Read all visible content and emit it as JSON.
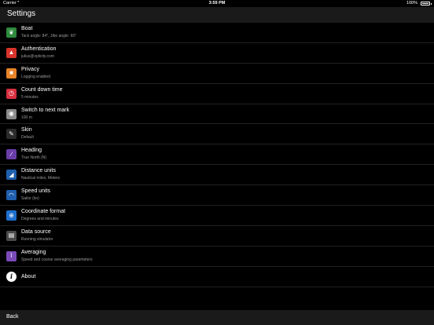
{
  "status_bar": {
    "carrier": "Carrier",
    "wifi_icon": "wifi-icon",
    "time": "3:59 PM",
    "battery_percent": "100%"
  },
  "nav": {
    "title": "Settings"
  },
  "settings": [
    {
      "label": "Boat",
      "sub": "Tack angle: 84°, Jibe angle: 60°",
      "icon": "leaf-icon",
      "color": "#2e8b3e",
      "glyph": "❦"
    },
    {
      "label": "Authentication",
      "sub": "julius@xplicity.com",
      "icon": "user-icon",
      "color": "#d9342b",
      "glyph": "▲"
    },
    {
      "label": "Privacy",
      "sub": "Logging enabled",
      "icon": "lock-icon",
      "color": "#e8832a",
      "glyph": "■"
    },
    {
      "label": "Count down time",
      "sub": "5 minutes",
      "icon": "timer-icon",
      "color": "#d93040",
      "glyph": "◷"
    },
    {
      "label": "Switch to next mark",
      "sub": "100 m",
      "icon": "target-icon",
      "color": "#8a8a8a",
      "glyph": "◉"
    },
    {
      "label": "Skin",
      "sub": "Default",
      "icon": "brush-icon",
      "color": "#2b2b2b",
      "glyph": "✎"
    },
    {
      "label": "Heading",
      "sub": "True North (N)",
      "icon": "heading-icon",
      "color": "#6a3ea8",
      "glyph": "∕"
    },
    {
      "label": "Distance units",
      "sub": "Nautical miles, Meters",
      "icon": "ruler-icon",
      "color": "#1f5fae",
      "glyph": "◢"
    },
    {
      "label": "Speed units",
      "sub": "Sailor (kn)",
      "icon": "speedometer-icon",
      "color": "#1f5fae",
      "glyph": "◠"
    },
    {
      "label": "Coordinate format",
      "sub": "Degrees and minutes",
      "icon": "globe-icon",
      "color": "#1f6fce",
      "glyph": "⊕"
    },
    {
      "label": "Data source",
      "sub": "Running simulator",
      "icon": "data-icon",
      "color": "#4a4a4a",
      "glyph": "▤"
    },
    {
      "label": "Averaging",
      "sub": "Speed and course averaging parameters",
      "icon": "graph-icon",
      "color": "#7a4ab8",
      "glyph": "⌇"
    }
  ],
  "about": {
    "label": "About",
    "icon": "info-icon",
    "glyph": "i"
  },
  "toolbar": {
    "back_label": "Back"
  }
}
